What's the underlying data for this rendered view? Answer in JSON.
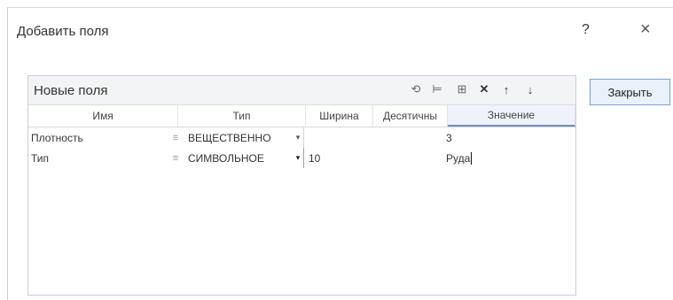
{
  "dialog": {
    "title": "Добавить поля",
    "help": "?",
    "close_icon": "×"
  },
  "panel": {
    "title": "Новые поля",
    "toolbar_icons": [
      "undo-icon",
      "insert-row-icon",
      "add-field-icon",
      "delete-icon",
      "move-up-icon",
      "move-down-icon"
    ]
  },
  "grid": {
    "columns": [
      "Имя",
      "Тип",
      "Ширина",
      "Десятичны",
      "Значение"
    ],
    "rows": [
      {
        "name": "Плотность",
        "type": "ВЕЩЕСТВЕННО",
        "width": "",
        "decimals": "",
        "value": "3"
      },
      {
        "name": "Тип",
        "type": "СИМВОЛЬНОЕ",
        "width": "10",
        "decimals": "",
        "value": "Руда"
      }
    ]
  },
  "buttons": {
    "close_label": "Закрыть"
  }
}
